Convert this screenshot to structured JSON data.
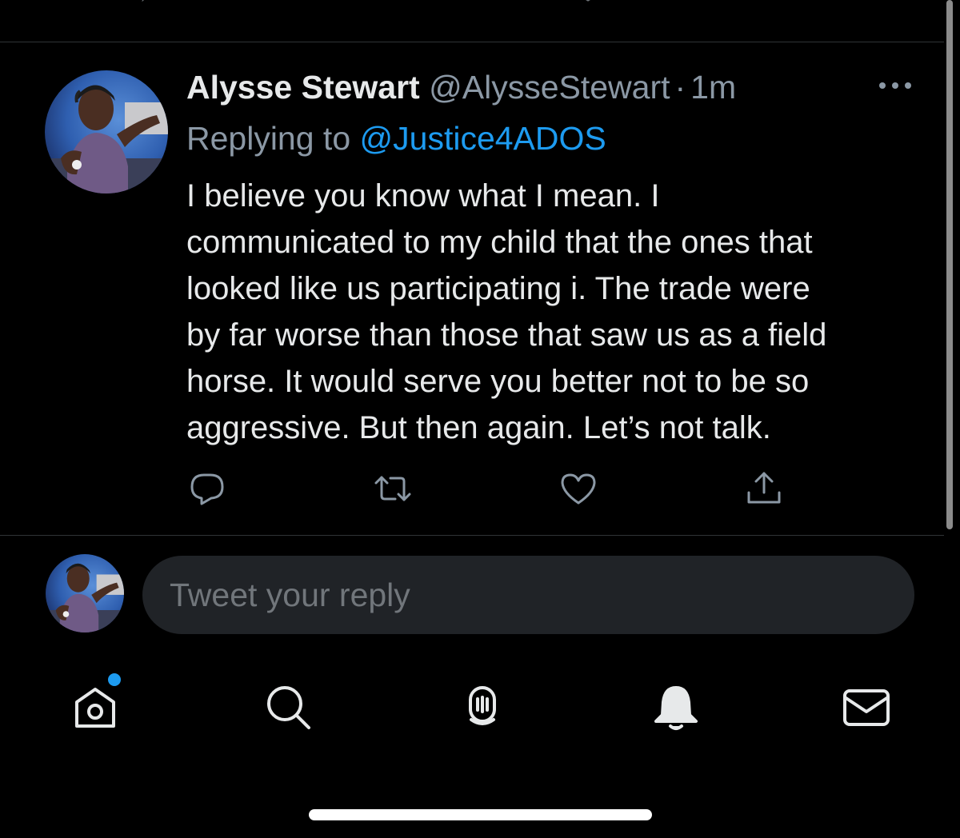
{
  "tweet": {
    "display_name": "Alysse Stewart",
    "handle": "@AlysseStewart",
    "separator": "·",
    "time": "1m",
    "replying_prefix": "Replying to ",
    "replying_to": "@Justice4ADOS",
    "text": "I believe you know what I mean. I\ncommunicated to my child that the ones that\nlooked like us participating i. The trade were\nby far worse than those that saw us as a field\nhorse.  It would serve you better not to be so\naggressive.  But then again.  Let’s not talk."
  },
  "reply_box": {
    "placeholder": "Tweet your reply"
  },
  "icons": {
    "top_actions": [
      "reply-icon",
      "retweet-icon",
      "like-icon",
      "share-icon"
    ],
    "tweet_actions": [
      "reply-icon",
      "retweet-icon",
      "like-icon",
      "share-icon"
    ],
    "more": "more-icon",
    "tab_bar": [
      "home-icon",
      "search-icon",
      "spaces-icon",
      "notifications-icon",
      "messages-icon"
    ]
  },
  "colors": {
    "background": "#000000",
    "text_primary": "#e7e9ea",
    "text_secondary": "#8b98a5",
    "accent": "#1d9bf0",
    "input_background": "#202327",
    "divider": "#2f3336"
  }
}
